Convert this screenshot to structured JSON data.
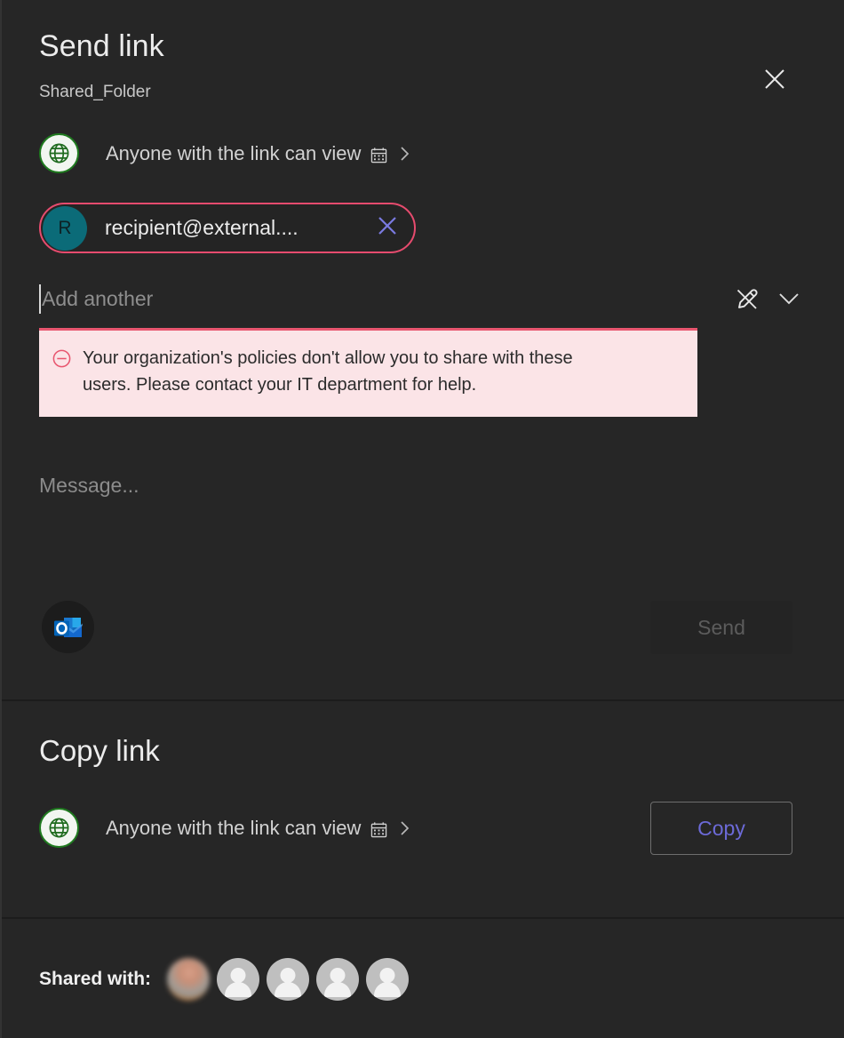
{
  "dialog": {
    "close_label": "Close"
  },
  "send": {
    "title": "Send link",
    "subtitle": "Shared_Folder",
    "link_setting": {
      "label": "Anyone with the link can view",
      "globe_icon": "globe-icon",
      "calendar_icon": "calendar-icon",
      "chevron_icon": "chevron-right-icon"
    },
    "recipient_chip": {
      "initial": "R",
      "text": "recipient@external....",
      "remove_icon": "close-icon"
    },
    "add_another": {
      "placeholder": "Add another",
      "edit_icon": "pencil-slash-icon",
      "expand_icon": "chevron-down-icon"
    },
    "error": {
      "icon": "block-circle-icon",
      "message": "Your organization's policies don't allow you to share with these users. Please contact your IT department for help."
    },
    "message": {
      "placeholder": "Message..."
    },
    "outlook_icon": "outlook-icon",
    "send_button": {
      "label": "Send",
      "disabled": true
    }
  },
  "copy": {
    "title": "Copy link",
    "link_setting": {
      "label": "Anyone with the link can view",
      "globe_icon": "globe-icon",
      "calendar_icon": "calendar-icon",
      "chevron_icon": "chevron-right-icon"
    },
    "copy_button": {
      "label": "Copy"
    }
  },
  "shared_with": {
    "label": "Shared with:",
    "avatars": [
      {
        "type": "photo"
      },
      {
        "type": "placeholder"
      },
      {
        "type": "placeholder"
      },
      {
        "type": "placeholder"
      },
      {
        "type": "placeholder"
      }
    ]
  },
  "colors": {
    "background": "#262626",
    "error_bg": "#fbe4e7",
    "error_accent": "#e8566f",
    "chip_border": "#e64b6e",
    "chip_avatar": "#0b6b78",
    "accent_link": "#6c6ad8",
    "globe_green": "#1f7a1f"
  }
}
